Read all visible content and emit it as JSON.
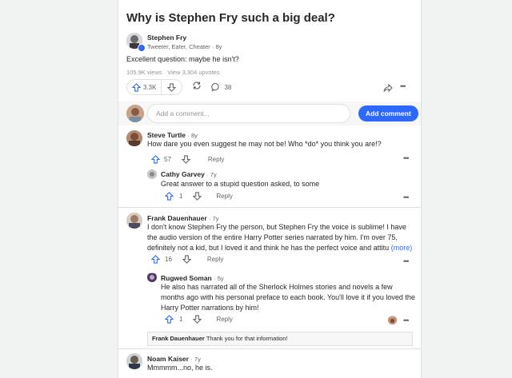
{
  "question": {
    "title": "Why is Stephen Fry such a big deal?"
  },
  "answer": {
    "author": "Stephen Fry",
    "credential": "Tweeter, Eater, Cheater",
    "age": "8y",
    "text": "Excellent question: maybe he isn't?",
    "stats": "105.9K views · View 3,304 upvotes",
    "upvotes": "3.3K",
    "comments": "38"
  },
  "composer": {
    "placeholder": "Add a comment...",
    "button": "Add comment"
  },
  "comments": [
    {
      "author": "Steve Turtle",
      "age": "· 8y",
      "text": "How dare you even suggest he may not be! Who *do* you think you are!?",
      "upvotes": "57",
      "reply": "Reply"
    },
    {
      "author": "Cathy Garvey",
      "age": "· 7y",
      "text": "Great answer to a stupid question asked, to some",
      "upvotes": "1",
      "reply": "Reply"
    },
    {
      "author": "Frank Dauenhauer",
      "age": "· 7y",
      "text": "I don't know Stephen Fry the person, but Stephen Fry the voice is sublime! I have the audio version of the entire Harry Potter series narrated by him. I'm over 75, definitely not a kid, but I loved it and think he has the perfect voice and attitu",
      "more": "(more)",
      "upvotes": "16",
      "reply": "Reply"
    },
    {
      "author": "Rugwed Soman",
      "age": "· 5y",
      "text": "He also has narrated all of the Sherlock Holmes stories and novels a few months ago with his personal preface to each book. You'll love it if you loved the Harry Potter narrations by him!",
      "upvotes": "1",
      "reply": "Reply"
    },
    {
      "author": "Noam Kaiser",
      "age": "· 7y",
      "text": "Mmmmm...no, he is."
    }
  ],
  "collapsed_reply": {
    "author": "Frank Dauenhauer",
    "text": "Thank you for that information!"
  },
  "colors": {
    "accent": "#2e69ff",
    "text": "#282829",
    "muted": "#636466",
    "border": "#dee0e1"
  }
}
